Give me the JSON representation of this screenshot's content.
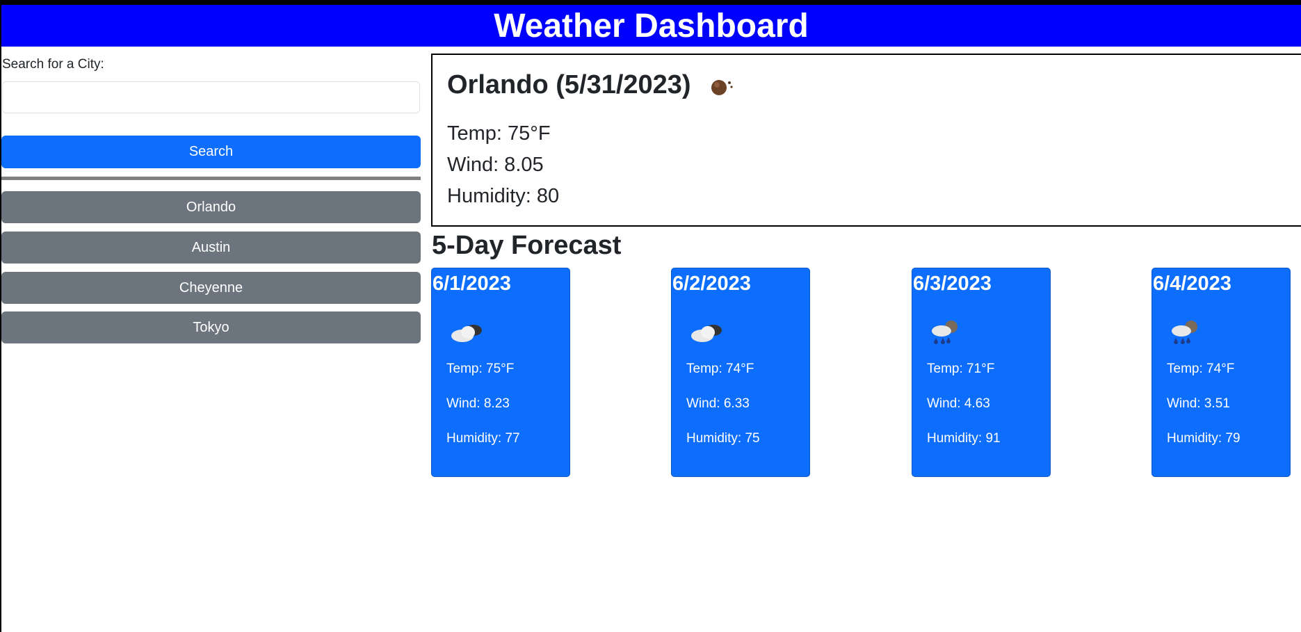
{
  "header": {
    "title": "Weather Dashboard"
  },
  "search": {
    "label": "Search for a City:",
    "value": "",
    "placeholder": "",
    "button_label": "Search"
  },
  "history": [
    {
      "label": "Orlando"
    },
    {
      "label": "Austin"
    },
    {
      "label": "Cheyenne"
    },
    {
      "label": "Tokyo"
    }
  ],
  "current": {
    "title": "Orlando (5/31/2023)",
    "icon": "moon-icon",
    "temp": "Temp: 75°F",
    "wind": "Wind: 8.05",
    "humidity": "Humidity: 80"
  },
  "forecast": {
    "heading": "5-Day Forecast",
    "days": [
      {
        "date": "6/1/2023",
        "icon": "cloud-icon",
        "temp": "Temp: 75°F",
        "wind": "Wind: 8.23",
        "humidity": "Humidity: 77"
      },
      {
        "date": "6/2/2023",
        "icon": "cloud-icon",
        "temp": "Temp: 74°F",
        "wind": "Wind: 6.33",
        "humidity": "Humidity: 75"
      },
      {
        "date": "6/3/2023",
        "icon": "rain-icon",
        "temp": "Temp: 71°F",
        "wind": "Wind: 4.63",
        "humidity": "Humidity: 91"
      },
      {
        "date": "6/4/2023",
        "icon": "rain-icon",
        "temp": "Temp: 74°F",
        "wind": "Wind: 3.51",
        "humidity": "Humidity: 79"
      }
    ]
  },
  "colors": {
    "banner": "#0000ff",
    "primary": "#0d6efd",
    "secondary": "#6c757d"
  }
}
